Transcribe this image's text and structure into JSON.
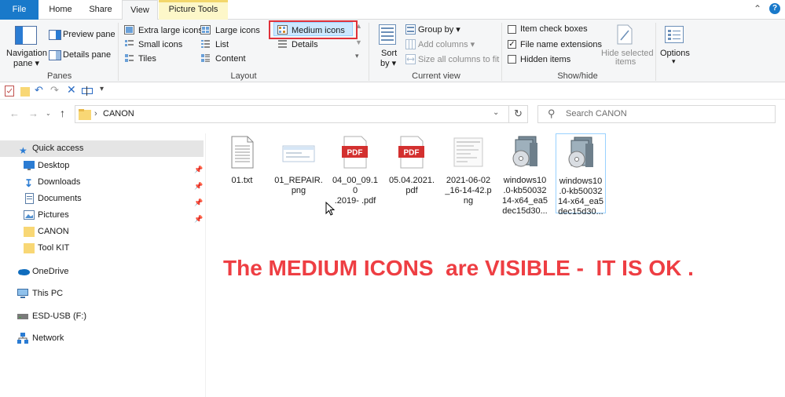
{
  "tabs": {
    "file": "File",
    "home": "Home",
    "share": "Share",
    "view": "View",
    "picture_tools": "Picture Tools"
  },
  "ribbon": {
    "panes": {
      "label": "Panes",
      "navigation_pane_line1": "Navigation",
      "navigation_pane_line2": "pane ▾",
      "preview_pane": "Preview pane",
      "details_pane": "Details pane"
    },
    "layout": {
      "label": "Layout",
      "extra_large_icons": "Extra large icons",
      "large_icons": "Large icons",
      "medium_icons": "Medium icons",
      "small_icons": "Small icons",
      "list": "List",
      "details": "Details",
      "tiles": "Tiles",
      "content": "Content"
    },
    "current_view": {
      "label": "Current view",
      "sort_line1": "Sort",
      "sort_line2": "by ▾",
      "group_by": "Group by ▾",
      "add_columns": "Add columns ▾",
      "size_all_columns": "Size all columns to fit"
    },
    "show_hide": {
      "label": "Show/hide",
      "item_check_boxes": "Item check boxes",
      "file_name_extensions": "File name extensions",
      "hidden_items": "Hidden items",
      "hide_selected_line1": "Hide selected",
      "hide_selected_line2": "items",
      "item_check_boxes_checked": false,
      "file_name_extensions_checked": true,
      "hidden_items_checked": false
    },
    "options": {
      "label": "Options",
      "arrow": "▾"
    }
  },
  "address": {
    "path": "CANON",
    "search_placeholder": "Search CANON"
  },
  "nav": {
    "quick_access": "Quick access",
    "desktop": "Desktop",
    "downloads": "Downloads",
    "documents": "Documents",
    "pictures": "Pictures",
    "canon": "CANON",
    "tool_kit": "Tool KIT",
    "onedrive": "OneDrive",
    "this_pc": "This PC",
    "esd_usb": "ESD-USB (F:)",
    "network": "Network"
  },
  "files": [
    {
      "name": "01.txt",
      "type": "txt-icon"
    },
    {
      "name": "01_REPAIR.\npng",
      "type": "png-thumbnail-icon"
    },
    {
      "name": "04_00_09.10\n.2019- .pdf",
      "type": "pdf-icon",
      "badge": "PDF"
    },
    {
      "name": "05.04.2021.\npdf",
      "type": "pdf-icon",
      "badge": "PDF"
    },
    {
      "name": "2021-06-02\n_16-14-42.p\nng",
      "type": "screenshot-thumbnail-icon"
    },
    {
      "name": "windows10\n.0-kb50032\n14-x64_ea5\ndec15d30...",
      "type": "msu-installer-icon"
    },
    {
      "name": "windows10\n.0-kb50032\n14-x64_ea5\ndec15d30...",
      "type": "msu-installer-icon"
    }
  ],
  "message": "The MEDIUM ICONS  are VISIBLE -  IT IS OK .",
  "colors": {
    "file_tab": "#1979ca",
    "selection": "#cce8ff",
    "annotation_red": "#ee3e43",
    "picture_tools_bg": "#fdf7c9"
  }
}
